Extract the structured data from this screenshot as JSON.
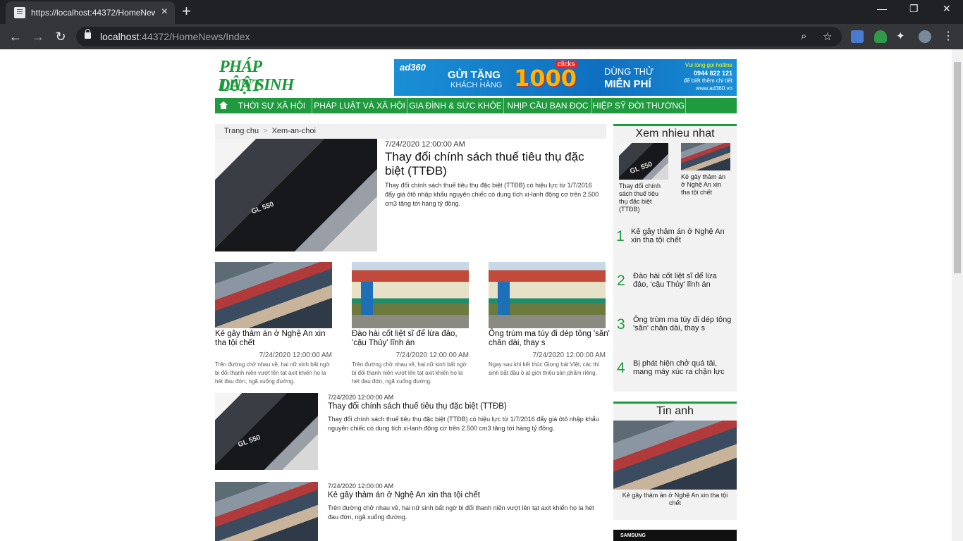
{
  "browser": {
    "tab_title": "https://localhost:44372/HomeNews/Index",
    "tab_close": "×",
    "new_tab": "+",
    "win_minimize": "—",
    "win_maximize": "❐",
    "win_close": "✕",
    "url_host": "localhost",
    "url_rest": ":44372/HomeNews/Index"
  },
  "site": {
    "logo_line1": "PHÁP LUẬT",
    "logo_line2": "DÂN SINH",
    "logo_color": "#1a9a3a",
    "banner": {
      "brand": "ad360",
      "gift": "GỬI TẶNG",
      "customers": "KHÁCH HÀNG",
      "big_number": "1000",
      "clicks": "clicks",
      "try": "DÙNG THỬ",
      "free": "MIỄN PHÍ",
      "r1": "Vui lòng gọi hotline",
      "r2": "0944 822 121",
      "r3": "để biết thêm chi tiết",
      "r4": "www.ad360.vn"
    },
    "nav": [
      "THỜI SỰ XÃ HỘI",
      "PHÁP LUẬT VÀ XÃ HỘI",
      "GIA ĐÌNH & SỨC KHỎE",
      "NHỊP CẦU BẠN ĐỌC",
      "HIỆP SỸ ĐỜI THƯỜNG"
    ],
    "accent_color": "#1f9a3e"
  },
  "breadcrumb": {
    "home": "Trang chu",
    "separator": ">",
    "current": "Xem-an-choi"
  },
  "featured": {
    "date": "7/24/2020 12:00:00 AM",
    "title": "Thay đổi chính sách thuế tiêu thụ đặc biệt (TTĐB)",
    "desc": "Thay đổi chính sách thuế tiêu thụ đặc biệt (TTĐB) có hiệu lực từ 1/7/2016 đẩy giá ôtô nhập khẩu nguyên chiếc có dung tích xi-lanh động cơ trên 2.500 cm3 tăng tới hàng tỷ đồng."
  },
  "grid": [
    {
      "title": "Kẻ gây thảm án ở Nghệ An xin tha tội chết",
      "date": "7/24/2020 12:00:00 AM",
      "desc": "Trên đường chở nhau về, hai nữ sinh bất ngờ bị đối thanh niên vượt lên tạt axit khiến họ la hét đau đớn, ngã xuống đường."
    },
    {
      "title": "Đào hài cốt liệt sĩ để lừa đảo, 'cậu Thủy' lĩnh án",
      "date": "7/24/2020 12:00:00 AM",
      "desc": "Trên đường chở nhau về, hai nữ sinh bất ngờ bị đối thanh niên vượt lên tạt axit khiến họ la hét đau đớn, ngã xuống đường."
    },
    {
      "title": "Ông trùm ma túy đi dép tông 'săn' chân dài, thay s",
      "date": "7/24/2020 12:00:00 AM",
      "desc": "Ngay sau khi kết thúc Giọng hát Việt, các thí sinh bắt đầu ồ ạt giới thiệu sản phẩm riêng."
    }
  ],
  "list": [
    {
      "date": "7/24/2020 12:00:00 AM",
      "title": "Thay đổi chính sách thuế tiêu thụ đặc biệt (TTĐB)",
      "desc": "Thay đổi chính sách thuế tiêu thụ đặc biệt (TTĐB) có hiệu lực từ 1/7/2016 đẩy giá ôtô nhập khẩu nguyên chiếc có dung tích xi-lanh động cơ trên 2.500 cm3 tăng tới hàng tỷ đồng."
    },
    {
      "date": "7/24/2020 12:00:00 AM",
      "title": "Kẻ gây thảm án ở Nghệ An xin tha tội chết",
      "desc": "Trên đường chở nhau về, hai nữ sinh bất ngờ bị đối thanh niên vượt lên tạt axit khiến họ la hét đau đớn, ngã xuống đường."
    }
  ],
  "most_viewed": {
    "title": "Xem nhieu nhat",
    "thumbs": [
      {
        "caption": "Thay đổi chính sách thuế tiêu thụ đặc biệt (TTĐB)"
      },
      {
        "caption": "Kẻ gây thảm án ở Nghệ An xin tha tội chết"
      }
    ],
    "ranked": [
      {
        "num": "1",
        "text": "Kẻ gây thảm án ở Nghệ An xin tha tội chết"
      },
      {
        "num": "2",
        "text": "Đào hài cốt liệt sĩ để lừa đảo, 'cậu Thủy' lĩnh án"
      },
      {
        "num": "3",
        "text": "Ông trùm ma túy đi dép tông 'săn' chân dài, thay s"
      },
      {
        "num": "4",
        "text": "Bị phát hiện chở quá tải, mang máy xúc ra chặn lực"
      }
    ]
  },
  "photo_news": {
    "title": "Tin anh",
    "caption": "Kẻ gây thảm án ở Nghệ An xin tha tội chết"
  },
  "ad_bottom": {
    "brand": "SAMSUNG"
  }
}
